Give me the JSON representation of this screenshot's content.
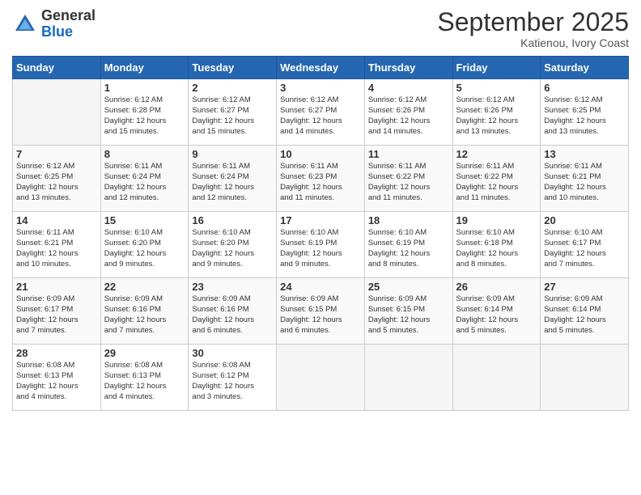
{
  "logo": {
    "general": "General",
    "blue": "Blue"
  },
  "header": {
    "month": "September 2025",
    "location": "Katienou, Ivory Coast"
  },
  "weekdays": [
    "Sunday",
    "Monday",
    "Tuesday",
    "Wednesday",
    "Thursday",
    "Friday",
    "Saturday"
  ],
  "weeks": [
    [
      {
        "day": "",
        "info": ""
      },
      {
        "day": "1",
        "info": "Sunrise: 6:12 AM\nSunset: 6:28 PM\nDaylight: 12 hours\nand 15 minutes."
      },
      {
        "day": "2",
        "info": "Sunrise: 6:12 AM\nSunset: 6:27 PM\nDaylight: 12 hours\nand 15 minutes."
      },
      {
        "day": "3",
        "info": "Sunrise: 6:12 AM\nSunset: 6:27 PM\nDaylight: 12 hours\nand 14 minutes."
      },
      {
        "day": "4",
        "info": "Sunrise: 6:12 AM\nSunset: 6:26 PM\nDaylight: 12 hours\nand 14 minutes."
      },
      {
        "day": "5",
        "info": "Sunrise: 6:12 AM\nSunset: 6:26 PM\nDaylight: 12 hours\nand 13 minutes."
      },
      {
        "day": "6",
        "info": "Sunrise: 6:12 AM\nSunset: 6:25 PM\nDaylight: 12 hours\nand 13 minutes."
      }
    ],
    [
      {
        "day": "7",
        "info": "Sunrise: 6:12 AM\nSunset: 6:25 PM\nDaylight: 12 hours\nand 13 minutes."
      },
      {
        "day": "8",
        "info": "Sunrise: 6:11 AM\nSunset: 6:24 PM\nDaylight: 12 hours\nand 12 minutes."
      },
      {
        "day": "9",
        "info": "Sunrise: 6:11 AM\nSunset: 6:24 PM\nDaylight: 12 hours\nand 12 minutes."
      },
      {
        "day": "10",
        "info": "Sunrise: 6:11 AM\nSunset: 6:23 PM\nDaylight: 12 hours\nand 11 minutes."
      },
      {
        "day": "11",
        "info": "Sunrise: 6:11 AM\nSunset: 6:22 PM\nDaylight: 12 hours\nand 11 minutes."
      },
      {
        "day": "12",
        "info": "Sunrise: 6:11 AM\nSunset: 6:22 PM\nDaylight: 12 hours\nand 11 minutes."
      },
      {
        "day": "13",
        "info": "Sunrise: 6:11 AM\nSunset: 6:21 PM\nDaylight: 12 hours\nand 10 minutes."
      }
    ],
    [
      {
        "day": "14",
        "info": "Sunrise: 6:11 AM\nSunset: 6:21 PM\nDaylight: 12 hours\nand 10 minutes."
      },
      {
        "day": "15",
        "info": "Sunrise: 6:10 AM\nSunset: 6:20 PM\nDaylight: 12 hours\nand 9 minutes."
      },
      {
        "day": "16",
        "info": "Sunrise: 6:10 AM\nSunset: 6:20 PM\nDaylight: 12 hours\nand 9 minutes."
      },
      {
        "day": "17",
        "info": "Sunrise: 6:10 AM\nSunset: 6:19 PM\nDaylight: 12 hours\nand 9 minutes."
      },
      {
        "day": "18",
        "info": "Sunrise: 6:10 AM\nSunset: 6:19 PM\nDaylight: 12 hours\nand 8 minutes."
      },
      {
        "day": "19",
        "info": "Sunrise: 6:10 AM\nSunset: 6:18 PM\nDaylight: 12 hours\nand 8 minutes."
      },
      {
        "day": "20",
        "info": "Sunrise: 6:10 AM\nSunset: 6:17 PM\nDaylight: 12 hours\nand 7 minutes."
      }
    ],
    [
      {
        "day": "21",
        "info": "Sunrise: 6:09 AM\nSunset: 6:17 PM\nDaylight: 12 hours\nand 7 minutes."
      },
      {
        "day": "22",
        "info": "Sunrise: 6:09 AM\nSunset: 6:16 PM\nDaylight: 12 hours\nand 7 minutes."
      },
      {
        "day": "23",
        "info": "Sunrise: 6:09 AM\nSunset: 6:16 PM\nDaylight: 12 hours\nand 6 minutes."
      },
      {
        "day": "24",
        "info": "Sunrise: 6:09 AM\nSunset: 6:15 PM\nDaylight: 12 hours\nand 6 minutes."
      },
      {
        "day": "25",
        "info": "Sunrise: 6:09 AM\nSunset: 6:15 PM\nDaylight: 12 hours\nand 5 minutes."
      },
      {
        "day": "26",
        "info": "Sunrise: 6:09 AM\nSunset: 6:14 PM\nDaylight: 12 hours\nand 5 minutes."
      },
      {
        "day": "27",
        "info": "Sunrise: 6:09 AM\nSunset: 6:14 PM\nDaylight: 12 hours\nand 5 minutes."
      }
    ],
    [
      {
        "day": "28",
        "info": "Sunrise: 6:08 AM\nSunset: 6:13 PM\nDaylight: 12 hours\nand 4 minutes."
      },
      {
        "day": "29",
        "info": "Sunrise: 6:08 AM\nSunset: 6:13 PM\nDaylight: 12 hours\nand 4 minutes."
      },
      {
        "day": "30",
        "info": "Sunrise: 6:08 AM\nSunset: 6:12 PM\nDaylight: 12 hours\nand 3 minutes."
      },
      {
        "day": "",
        "info": ""
      },
      {
        "day": "",
        "info": ""
      },
      {
        "day": "",
        "info": ""
      },
      {
        "day": "",
        "info": ""
      }
    ]
  ]
}
